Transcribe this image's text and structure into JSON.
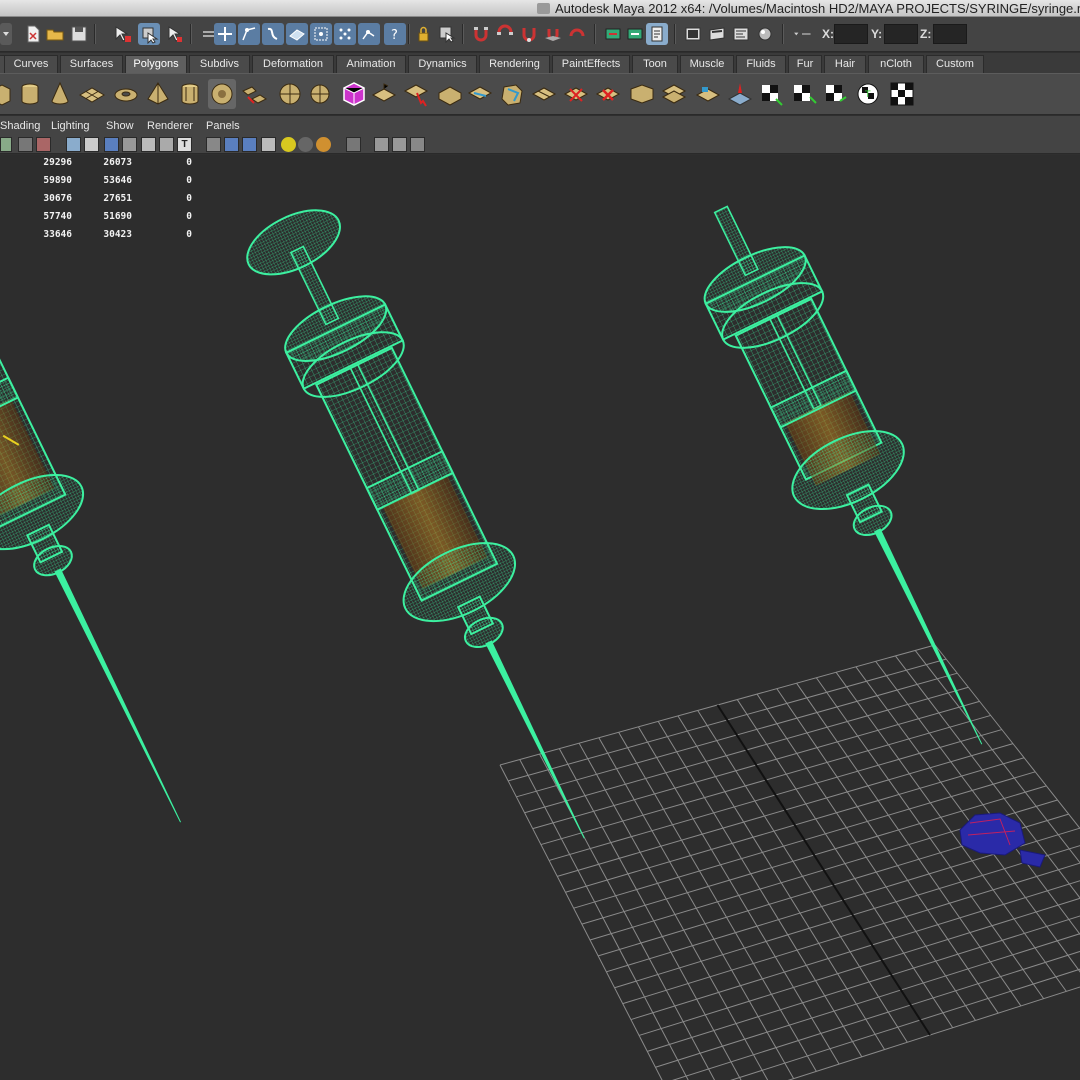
{
  "window": {
    "title": "Autodesk Maya 2012 x64: /Volumes/Macintosh HD2/MAYA PROJECTS/SYRINGE/syringe.m"
  },
  "status_line": {
    "icons": [
      "menu-set-dropdown",
      "new-scene-icon",
      "open-scene-icon",
      "save-scene-icon",
      "select-hierarchy-icon",
      "select-object-icon",
      "select-component-icon",
      "lock-selection-icon",
      "snap-grid-icon",
      "snap-curve-icon",
      "snap-point-icon",
      "snap-view-plane-icon",
      "make-live-icon",
      "input-ops-icon",
      "output-ops-icon",
      "construction-history-icon",
      "render-current-frame-icon",
      "ipr-render-icon",
      "render-settings-icon",
      "hypershade-icon",
      "render-view-icon",
      "show-hide-attribute-editor-icon"
    ],
    "x_label": "X:",
    "y_label": "Y:",
    "z_label": "Z:",
    "x_value": "",
    "y_value": "",
    "z_value": ""
  },
  "shelf_tabs": [
    {
      "label": "Curves",
      "active": false
    },
    {
      "label": "Surfaces",
      "active": false
    },
    {
      "label": "Polygons",
      "active": true
    },
    {
      "label": "Subdivs",
      "active": false
    },
    {
      "label": "Deformation",
      "active": false
    },
    {
      "label": "Animation",
      "active": false
    },
    {
      "label": "Dynamics",
      "active": false
    },
    {
      "label": "Rendering",
      "active": false
    },
    {
      "label": "PaintEffects",
      "active": false
    },
    {
      "label": "Toon",
      "active": false
    },
    {
      "label": "Muscle",
      "active": false
    },
    {
      "label": "Fluids",
      "active": false
    },
    {
      "label": "Fur",
      "active": false
    },
    {
      "label": "Hair",
      "active": false
    },
    {
      "label": "nCloth",
      "active": false
    },
    {
      "label": "Custom",
      "active": false
    }
  ],
  "panel_menu": [
    "Shading",
    "Lighting",
    "Show",
    "Renderer",
    "Panels"
  ],
  "heads_up_display": {
    "rows": [
      [
        "29296",
        "26073",
        "0"
      ],
      [
        "59890",
        "53646",
        "0"
      ],
      [
        "30676",
        "27651",
        "0"
      ],
      [
        "57740",
        "51690",
        "0"
      ],
      [
        "33646",
        "30423",
        "0"
      ]
    ]
  },
  "colors": {
    "wireframe": "#3cf0a0",
    "viewport_bg": "#2d2d2d",
    "grid": "#8a8a8a",
    "selected_object": "#2222aa",
    "shelf_bg": "#4b4b4b"
  }
}
